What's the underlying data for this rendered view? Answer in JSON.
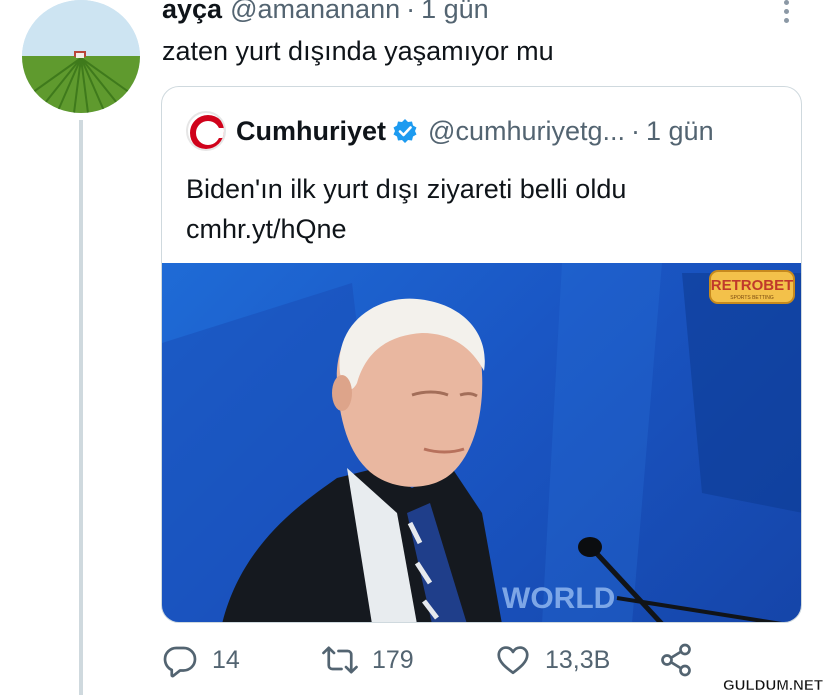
{
  "tweet": {
    "display_name": "ayça",
    "handle": "@amananann",
    "separator": "·",
    "time": "1 gün",
    "text": "zaten yurt dışında yaşamıyor mu"
  },
  "quote": {
    "display_name": "Cumhuriyet",
    "handle": "@cumhuriyetg...",
    "separator": "·",
    "time": "1 gün",
    "text_line1": "Biden'ın ilk yurt dışı ziyareti belli oldu",
    "text_line2": "cmhr.yt/hQne",
    "image": {
      "watermark_text": "RETROBET",
      "watermark_subtext": "SPORTS BETTING",
      "podium_text": "WORLD"
    }
  },
  "actions": {
    "replies": "14",
    "retweets": "179",
    "likes": "13,3B"
  },
  "site_badge": "GULDUM.NET",
  "colors": {
    "text": "#0f1419",
    "secondary": "#536471",
    "border": "#cfd9de",
    "verified": "#1d9bf0",
    "brand_red": "#d0021b"
  },
  "icons": {
    "reply": "reply-icon",
    "retweet": "retweet-icon",
    "like": "heart-icon",
    "share": "share-icon",
    "more": "more-icon",
    "verified": "verified-badge-icon"
  }
}
